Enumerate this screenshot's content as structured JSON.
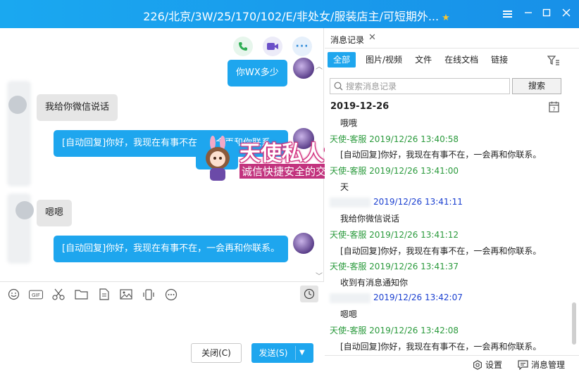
{
  "window": {
    "title": "226/北京/3W/25/170/102/E/非处女/服装店主/可短期外...",
    "colors": {
      "titlebar": "#1890e8",
      "accent": "#1ea6ee"
    }
  },
  "chat": {
    "messages": [
      {
        "side": "right",
        "text": "你WX多少"
      },
      {
        "side": "left",
        "text": "我给你微信说话"
      },
      {
        "side": "right",
        "text": "[自动回复]你好，我现在有事不在，一会再和你联系。"
      },
      {
        "side": "left",
        "text": "嗯嗯"
      },
      {
        "side": "right",
        "text": "[自动回复]你好，我现在有事不在，一会再和你联系。"
      }
    ],
    "banner": {
      "title": "天使私人订制",
      "subtitle": "诚信快捷安全的交友平台",
      "hidden_bubble_fragment": "你好，"
    }
  },
  "toolbar": {
    "icons": [
      "emoji-icon",
      "gif-icon",
      "scissors-icon",
      "folder-icon",
      "document-icon",
      "image-icon",
      "shake-icon",
      "more-icon"
    ],
    "gif_label": "GIF"
  },
  "footer": {
    "close_label": "关闭(C)",
    "send_label": "发送(S)"
  },
  "history": {
    "tab_label": "消息记录",
    "filters": [
      "全部",
      "图片/视频",
      "文件",
      "在线文档",
      "链接"
    ],
    "search_placeholder": "搜索消息记录",
    "search_button": "搜索",
    "date": "2019-12-26",
    "records": [
      {
        "type": "body",
        "text": "哦哦"
      },
      {
        "type": "sender",
        "sender": "天使-客服",
        "time": "2019/12/26 13:40:58",
        "color": "green"
      },
      {
        "type": "body",
        "text": "[自动回复]你好，我现在有事不在，一会再和你联系。"
      },
      {
        "type": "sender",
        "sender": "天使-客服",
        "time": "2019/12/26 13:41:00",
        "color": "green"
      },
      {
        "type": "body",
        "text": "天"
      },
      {
        "type": "sender",
        "sender": "",
        "time": "2019/12/26 13:41:11",
        "color": "blue"
      },
      {
        "type": "body",
        "text": "我给你微信说话"
      },
      {
        "type": "sender",
        "sender": "天使-客服",
        "time": "2019/12/26 13:41:12",
        "color": "green"
      },
      {
        "type": "body",
        "text": "[自动回复]你好，我现在有事不在，一会再和你联系。"
      },
      {
        "type": "sender",
        "sender": "天使-客服",
        "time": "2019/12/26 13:41:37",
        "color": "green"
      },
      {
        "type": "body",
        "text": "收到有消息通知你"
      },
      {
        "type": "sender",
        "sender": "",
        "time": "2019/12/26 13:42:07",
        "color": "blue"
      },
      {
        "type": "body",
        "text": "嗯嗯"
      },
      {
        "type": "sender",
        "sender": "天使-客服",
        "time": "2019/12/26 13:42:08",
        "color": "green"
      },
      {
        "type": "body",
        "text": "[自动回复]你好，我现在有事不在，一会再和你联系。"
      }
    ],
    "settings_label": "设置",
    "manage_label": "消息管理"
  }
}
